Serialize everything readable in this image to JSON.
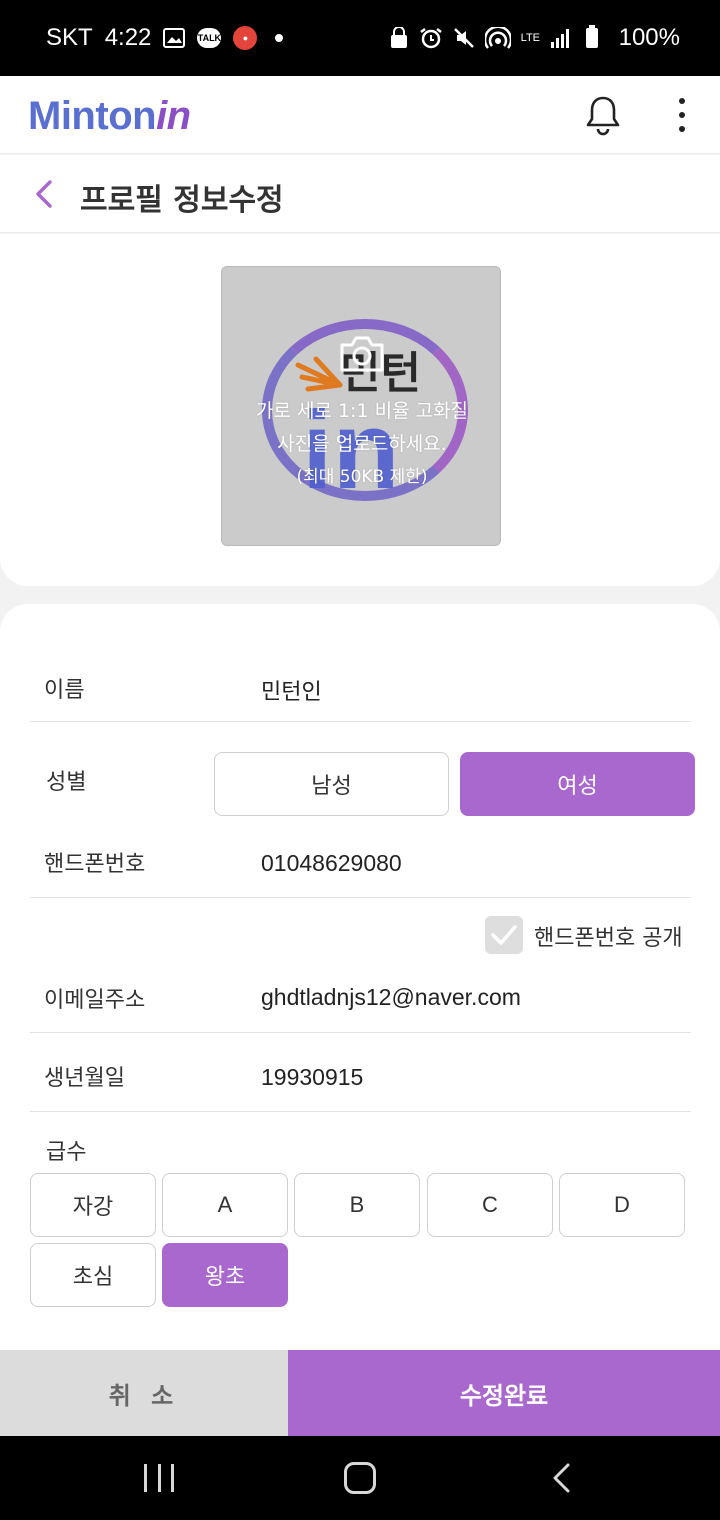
{
  "status_bar": {
    "carrier": "SKT",
    "time": "4:22",
    "talk_badge": "TALK",
    "network": "LTE",
    "battery": "100%"
  },
  "header": {
    "logo_main": "Minton",
    "logo_suffix": "in"
  },
  "page": {
    "title": "프로필 정보수정"
  },
  "photo": {
    "watermark_text": "민턴",
    "watermark_in": "in",
    "hint_line1": "가로 세로 1:1 비율 고화질",
    "hint_line2": "사진을 업로드하세요.",
    "hint_line3": "(최대 50KB 제한)"
  },
  "form": {
    "name": {
      "label": "이름",
      "value": "민턴인"
    },
    "gender": {
      "label": "성별",
      "options": [
        "남성",
        "여성"
      ],
      "selected": "여성"
    },
    "phone": {
      "label": "핸드폰번호",
      "value": "01048629080",
      "public_label": "핸드폰번호 공개"
    },
    "email": {
      "label": "이메일주소",
      "value": "ghdtladnjs12@naver.com"
    },
    "birth": {
      "label": "생년월일",
      "value": "19930915"
    },
    "grade": {
      "label": "급수",
      "options": [
        "자강",
        "A",
        "B",
        "C",
        "D",
        "초심",
        "왕초"
      ],
      "selected": "왕초"
    }
  },
  "actions": {
    "cancel": "취 소",
    "submit": "수정완료"
  },
  "colors": {
    "accent": "#a868cd",
    "logo_blue": "#5b6fd0",
    "logo_purple": "#8a4fc4"
  }
}
